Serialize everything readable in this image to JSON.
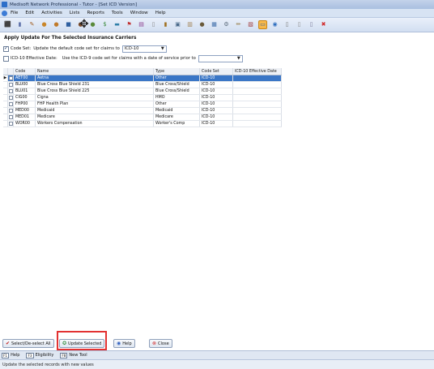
{
  "window": {
    "title": "Medisoft Network Professional - Tutor - [Set ICD Version]"
  },
  "menu": [
    "File",
    "Edit",
    "Activities",
    "Lists",
    "Reports",
    "Tools",
    "Window",
    "Help"
  ],
  "toolbar_icons": [
    {
      "name": "exit-icon",
      "glyph": "⬛",
      "color": "#3a8a3a"
    },
    {
      "name": "book-icon",
      "glyph": "▮",
      "color": "#5b6fa8"
    },
    {
      "name": "pen-icon",
      "glyph": "✎",
      "color": "#a05a1a"
    },
    {
      "name": "person-icon",
      "glyph": "●",
      "color": "#c9862a"
    },
    {
      "name": "user-icon",
      "glyph": "●",
      "color": "#c07a2a"
    },
    {
      "name": "folder-icon",
      "glyph": "■",
      "color": "#2f5f9f"
    },
    {
      "name": "people-icon",
      "glyph": "●",
      "color": "#7a4a2a"
    },
    {
      "name": "group-icon",
      "glyph": "●",
      "color": "#5a8a3a"
    },
    {
      "name": "money-icon",
      "glyph": "$",
      "color": "#3a8a3a"
    },
    {
      "name": "card-icon",
      "glyph": "▬",
      "color": "#2f7fa8"
    },
    {
      "name": "flag-icon",
      "glyph": "⚑",
      "color": "#c03030"
    },
    {
      "name": "report-icon",
      "glyph": "▤",
      "color": "#8a3a8a"
    },
    {
      "name": "document-icon",
      "glyph": "▯",
      "color": "#888888"
    },
    {
      "name": "lock-icon",
      "glyph": "▮",
      "color": "#a07020"
    },
    {
      "name": "printer-icon",
      "glyph": "▣",
      "color": "#4a6a8a"
    },
    {
      "name": "clipboard-icon",
      "glyph": "▥",
      "color": "#a08050"
    },
    {
      "name": "users-icon",
      "glyph": "●",
      "color": "#6a5a3a"
    },
    {
      "name": "calendar-icon",
      "glyph": "▦",
      "color": "#3a6aa8"
    },
    {
      "name": "gear-icon",
      "glyph": "⚙",
      "color": "#5a6a7a"
    },
    {
      "name": "pencil-icon",
      "glyph": "✏",
      "color": "#8a6a2a"
    },
    {
      "name": "gift-icon",
      "glyph": "▧",
      "color": "#a03a3a"
    },
    {
      "name": "active-tool-icon",
      "glyph": "▭",
      "color": "#2f5f9f"
    },
    {
      "name": "globe-icon",
      "glyph": "◉",
      "color": "#2f6fbf"
    },
    {
      "name": "page-icon",
      "glyph": "▯",
      "color": "#7a7a7a"
    },
    {
      "name": "copy-icon",
      "glyph": "▯",
      "color": "#8a8a8a"
    },
    {
      "name": "notes-icon",
      "glyph": "▯",
      "color": "#7a7a9a"
    },
    {
      "name": "stop-icon",
      "glyph": "✖",
      "color": "#d02828"
    }
  ],
  "panel": {
    "title": "Apply Update For The Selected Insurance Carriers",
    "code_set": {
      "label": "Code Set:",
      "text": "Update the default code set for claims to",
      "value": "ICD-10"
    },
    "effective": {
      "label": "ICD-10 Effective Date:",
      "text": "Use the ICD-9 code set for claims with a date of service prior to",
      "value": ""
    }
  },
  "grid": {
    "columns": {
      "code": "Code",
      "name": "Name",
      "type": "Type",
      "code_set": "Code Set",
      "effective": "ICD-10 Effective Date"
    },
    "rows": [
      {
        "code": "AET00",
        "name": "Aetna",
        "type": "Other",
        "code_set": "ICD-10",
        "effective": "",
        "selected": true
      },
      {
        "code": "BLU00",
        "name": "Blue Cross Blue Shield 231",
        "type": "Blue Cross/Shield",
        "code_set": "ICD-10",
        "effective": "",
        "selected": false
      },
      {
        "code": "BLU01",
        "name": "Blue Cross Blue Shield 225",
        "type": "Blue Cross/Shield",
        "code_set": "ICD-10",
        "effective": "",
        "selected": false
      },
      {
        "code": "CIG00",
        "name": "Cigna",
        "type": "HMO",
        "code_set": "ICD-10",
        "effective": "",
        "selected": false
      },
      {
        "code": "FHP00",
        "name": "FHP Health Plan",
        "type": "Other",
        "code_set": "ICD-10",
        "effective": "",
        "selected": false
      },
      {
        "code": "MED00",
        "name": "Medicaid",
        "type": "Medicaid",
        "code_set": "ICD-10",
        "effective": "",
        "selected": false
      },
      {
        "code": "MED01",
        "name": "Medicare",
        "type": "Medicare",
        "code_set": "ICD-10",
        "effective": "",
        "selected": false
      },
      {
        "code": "WOR00",
        "name": "Workers Compensation",
        "type": "Worker's Comp",
        "code_set": "ICD-10",
        "effective": "",
        "selected": false
      }
    ]
  },
  "buttons": {
    "select_all": "Select/De-select All",
    "update_selected": "Update Selected",
    "help": "Help",
    "close": "Close"
  },
  "hotkeys": [
    {
      "key": "F1",
      "label": "Help"
    },
    {
      "key": "F3",
      "label": "Eligibility"
    },
    {
      "key": "F8",
      "label": "New Tool"
    }
  ],
  "status": {
    "text": "Update the selected records with new values"
  }
}
